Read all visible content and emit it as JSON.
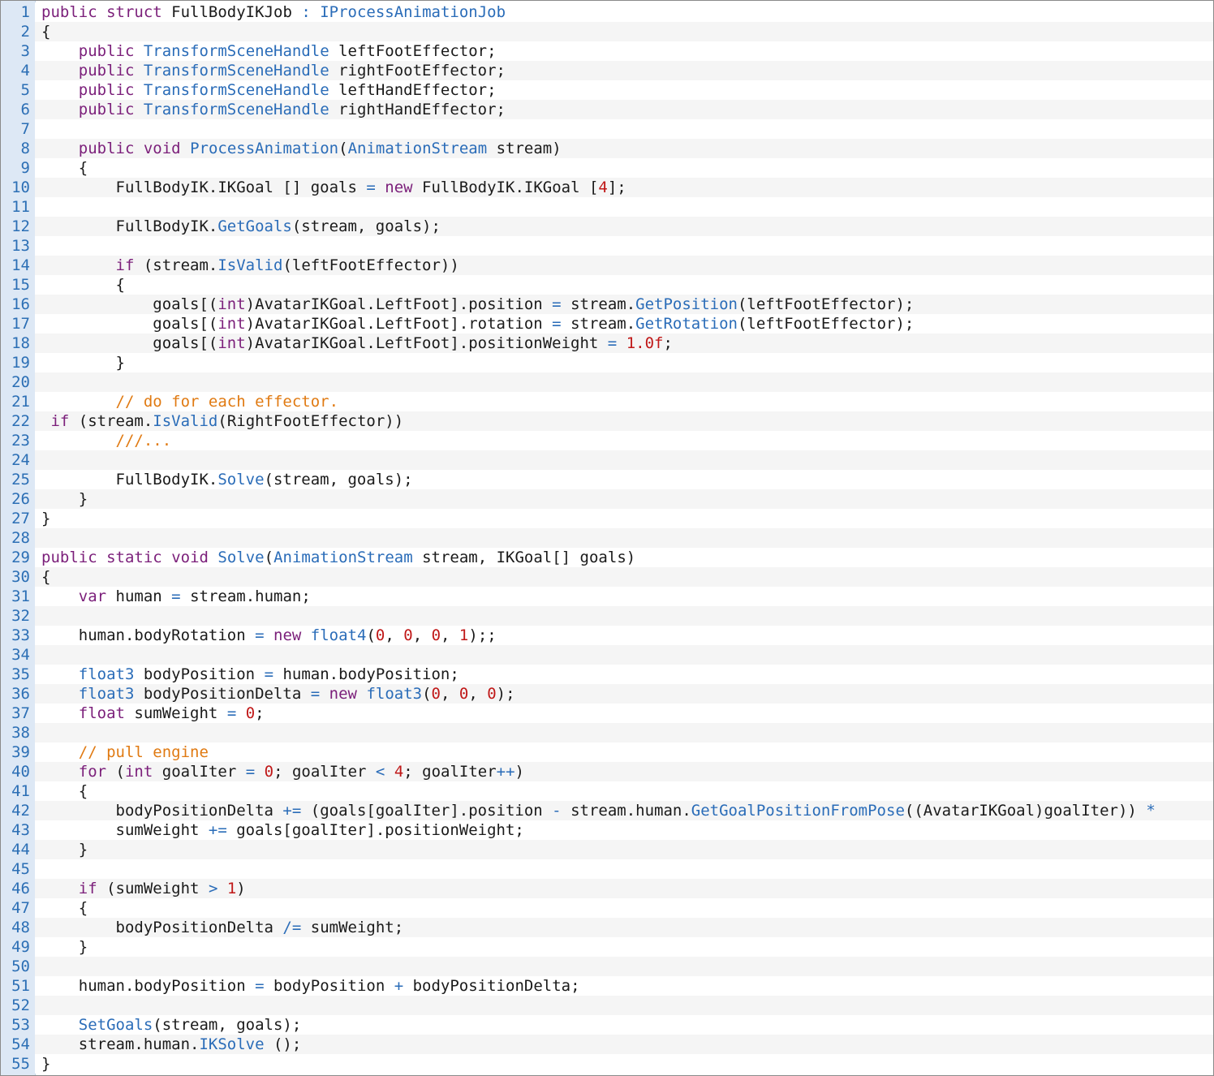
{
  "colors": {
    "keyword": "#7b1f7a",
    "type": "#2a6cb8",
    "number": "#c01818",
    "comment": "#e07a12",
    "text": "#1a1a1a",
    "line_number": "#2c6fb5",
    "gutter_bg": "#dde8f5",
    "alt_row_bg": "#f5f5f5"
  },
  "lines": [
    {
      "n": "1",
      "tokens": [
        [
          "kw",
          "public"
        ],
        [
          "p",
          " "
        ],
        [
          "kw",
          "struct"
        ],
        [
          "p",
          " FullBodyIKJob "
        ],
        [
          "op",
          ":"
        ],
        [
          "p",
          " "
        ],
        [
          "ty",
          "IProcessAnimationJob"
        ]
      ]
    },
    {
      "n": "2",
      "tokens": [
        [
          "p",
          "{"
        ]
      ]
    },
    {
      "n": "3",
      "tokens": [
        [
          "p",
          "    "
        ],
        [
          "kw",
          "public"
        ],
        [
          "p",
          " "
        ],
        [
          "ty",
          "TransformSceneHandle"
        ],
        [
          "p",
          " leftFootEffector;"
        ]
      ]
    },
    {
      "n": "4",
      "tokens": [
        [
          "p",
          "    "
        ],
        [
          "kw",
          "public"
        ],
        [
          "p",
          " "
        ],
        [
          "ty",
          "TransformSceneHandle"
        ],
        [
          "p",
          " rightFootEffector;"
        ]
      ]
    },
    {
      "n": "5",
      "tokens": [
        [
          "p",
          "    "
        ],
        [
          "kw",
          "public"
        ],
        [
          "p",
          " "
        ],
        [
          "ty",
          "TransformSceneHandle"
        ],
        [
          "p",
          " leftHandEffector;"
        ]
      ]
    },
    {
      "n": "6",
      "tokens": [
        [
          "p",
          "    "
        ],
        [
          "kw",
          "public"
        ],
        [
          "p",
          " "
        ],
        [
          "ty",
          "TransformSceneHandle"
        ],
        [
          "p",
          " rightHandEffector;"
        ]
      ]
    },
    {
      "n": "7",
      "tokens": []
    },
    {
      "n": "8",
      "tokens": [
        [
          "p",
          "    "
        ],
        [
          "kw",
          "public"
        ],
        [
          "p",
          " "
        ],
        [
          "kw",
          "void"
        ],
        [
          "p",
          " "
        ],
        [
          "fn",
          "ProcessAnimation"
        ],
        [
          "p",
          "("
        ],
        [
          "ty",
          "AnimationStream"
        ],
        [
          "p",
          " stream)"
        ]
      ]
    },
    {
      "n": "9",
      "tokens": [
        [
          "p",
          "    {"
        ]
      ]
    },
    {
      "n": "10",
      "tokens": [
        [
          "p",
          "        FullBodyIK.IKGoal [] goals "
        ],
        [
          "op",
          "="
        ],
        [
          "p",
          " "
        ],
        [
          "kw",
          "new"
        ],
        [
          "p",
          " FullBodyIK.IKGoal ["
        ],
        [
          "num",
          "4"
        ],
        [
          "p",
          "];"
        ]
      ]
    },
    {
      "n": "11",
      "tokens": []
    },
    {
      "n": "12",
      "tokens": [
        [
          "p",
          "        FullBodyIK."
        ],
        [
          "fn",
          "GetGoals"
        ],
        [
          "p",
          "(stream, goals);"
        ]
      ]
    },
    {
      "n": "13",
      "tokens": []
    },
    {
      "n": "14",
      "tokens": [
        [
          "p",
          "        "
        ],
        [
          "kw",
          "if"
        ],
        [
          "p",
          " (stream."
        ],
        [
          "fn",
          "IsValid"
        ],
        [
          "p",
          "(leftFootEffector))"
        ]
      ]
    },
    {
      "n": "15",
      "tokens": [
        [
          "p",
          "        {"
        ]
      ]
    },
    {
      "n": "16",
      "tokens": [
        [
          "p",
          "            goals[("
        ],
        [
          "kw",
          "int"
        ],
        [
          "p",
          ")AvatarIKGoal.LeftFoot].position "
        ],
        [
          "op",
          "="
        ],
        [
          "p",
          " stream."
        ],
        [
          "fn",
          "GetPosition"
        ],
        [
          "p",
          "(leftFootEffector);"
        ]
      ]
    },
    {
      "n": "17",
      "tokens": [
        [
          "p",
          "            goals[("
        ],
        [
          "kw",
          "int"
        ],
        [
          "p",
          ")AvatarIKGoal.LeftFoot].rotation "
        ],
        [
          "op",
          "="
        ],
        [
          "p",
          " stream."
        ],
        [
          "fn",
          "GetRotation"
        ],
        [
          "p",
          "(leftFootEffector);"
        ]
      ]
    },
    {
      "n": "18",
      "tokens": [
        [
          "p",
          "            goals[("
        ],
        [
          "kw",
          "int"
        ],
        [
          "p",
          ")AvatarIKGoal.LeftFoot].positionWeight "
        ],
        [
          "op",
          "="
        ],
        [
          "p",
          " "
        ],
        [
          "num",
          "1.0f"
        ],
        [
          "p",
          ";"
        ]
      ]
    },
    {
      "n": "19",
      "tokens": [
        [
          "p",
          "        }"
        ]
      ]
    },
    {
      "n": "20",
      "tokens": []
    },
    {
      "n": "21",
      "tokens": [
        [
          "p",
          "        "
        ],
        [
          "cm",
          "// do for each effector."
        ]
      ]
    },
    {
      "n": "22",
      "tokens": [
        [
          "p",
          " "
        ],
        [
          "kw",
          "if"
        ],
        [
          "p",
          " (stream."
        ],
        [
          "fn",
          "IsValid"
        ],
        [
          "p",
          "(RightFootEffector))"
        ]
      ]
    },
    {
      "n": "23",
      "tokens": [
        [
          "p",
          "        "
        ],
        [
          "cm",
          "///..."
        ]
      ]
    },
    {
      "n": "24",
      "tokens": []
    },
    {
      "n": "25",
      "tokens": [
        [
          "p",
          "        FullBodyIK."
        ],
        [
          "fn",
          "Solve"
        ],
        [
          "p",
          "(stream, goals);"
        ]
      ]
    },
    {
      "n": "26",
      "tokens": [
        [
          "p",
          "    }"
        ]
      ]
    },
    {
      "n": "27",
      "tokens": [
        [
          "p",
          "}"
        ]
      ]
    },
    {
      "n": "28",
      "tokens": []
    },
    {
      "n": "29",
      "tokens": [
        [
          "kw",
          "public"
        ],
        [
          "p",
          " "
        ],
        [
          "kw",
          "static"
        ],
        [
          "p",
          " "
        ],
        [
          "kw",
          "void"
        ],
        [
          "p",
          " "
        ],
        [
          "fn",
          "Solve"
        ],
        [
          "p",
          "("
        ],
        [
          "ty",
          "AnimationStream"
        ],
        [
          "p",
          " stream, IKGoal[] goals)"
        ]
      ]
    },
    {
      "n": "30",
      "tokens": [
        [
          "p",
          "{"
        ]
      ]
    },
    {
      "n": "31",
      "tokens": [
        [
          "p",
          "    "
        ],
        [
          "kw",
          "var"
        ],
        [
          "p",
          " human "
        ],
        [
          "op",
          "="
        ],
        [
          "p",
          " stream.human;"
        ]
      ]
    },
    {
      "n": "32",
      "tokens": []
    },
    {
      "n": "33",
      "tokens": [
        [
          "p",
          "    human.bodyRotation "
        ],
        [
          "op",
          "="
        ],
        [
          "p",
          " "
        ],
        [
          "kw",
          "new"
        ],
        [
          "p",
          " "
        ],
        [
          "ty",
          "float4"
        ],
        [
          "p",
          "("
        ],
        [
          "num",
          "0"
        ],
        [
          "p",
          ", "
        ],
        [
          "num",
          "0"
        ],
        [
          "p",
          ", "
        ],
        [
          "num",
          "0"
        ],
        [
          "p",
          ", "
        ],
        [
          "num",
          "1"
        ],
        [
          "p",
          ");;"
        ]
      ]
    },
    {
      "n": "34",
      "tokens": []
    },
    {
      "n": "35",
      "tokens": [
        [
          "p",
          "    "
        ],
        [
          "ty",
          "float3"
        ],
        [
          "p",
          " bodyPosition "
        ],
        [
          "op",
          "="
        ],
        [
          "p",
          " human.bodyPosition;"
        ]
      ]
    },
    {
      "n": "36",
      "tokens": [
        [
          "p",
          "    "
        ],
        [
          "ty",
          "float3"
        ],
        [
          "p",
          " bodyPositionDelta "
        ],
        [
          "op",
          "="
        ],
        [
          "p",
          " "
        ],
        [
          "kw",
          "new"
        ],
        [
          "p",
          " "
        ],
        [
          "ty",
          "float3"
        ],
        [
          "p",
          "("
        ],
        [
          "num",
          "0"
        ],
        [
          "p",
          ", "
        ],
        [
          "num",
          "0"
        ],
        [
          "p",
          ", "
        ],
        [
          "num",
          "0"
        ],
        [
          "p",
          ");"
        ]
      ]
    },
    {
      "n": "37",
      "tokens": [
        [
          "p",
          "    "
        ],
        [
          "kw",
          "float"
        ],
        [
          "p",
          " sumWeight "
        ],
        [
          "op",
          "="
        ],
        [
          "p",
          " "
        ],
        [
          "num",
          "0"
        ],
        [
          "p",
          ";"
        ]
      ]
    },
    {
      "n": "38",
      "tokens": []
    },
    {
      "n": "39",
      "tokens": [
        [
          "p",
          "    "
        ],
        [
          "cm",
          "// pull engine"
        ]
      ]
    },
    {
      "n": "40",
      "tokens": [
        [
          "p",
          "    "
        ],
        [
          "kw",
          "for"
        ],
        [
          "p",
          " ("
        ],
        [
          "kw",
          "int"
        ],
        [
          "p",
          " goalIter "
        ],
        [
          "op",
          "="
        ],
        [
          "p",
          " "
        ],
        [
          "num",
          "0"
        ],
        [
          "p",
          "; goalIter "
        ],
        [
          "op",
          "<"
        ],
        [
          "p",
          " "
        ],
        [
          "num",
          "4"
        ],
        [
          "p",
          "; goalIter"
        ],
        [
          "op",
          "++"
        ],
        [
          "p",
          ")"
        ]
      ]
    },
    {
      "n": "41",
      "tokens": [
        [
          "p",
          "    {"
        ]
      ]
    },
    {
      "n": "42",
      "tokens": [
        [
          "p",
          "        bodyPositionDelta "
        ],
        [
          "op",
          "+="
        ],
        [
          "p",
          " (goals[goalIter].position "
        ],
        [
          "op",
          "-"
        ],
        [
          "p",
          " stream.human."
        ],
        [
          "fn",
          "GetGoalPositionFromPose"
        ],
        [
          "p",
          "((AvatarIKGoal)goalIter)) "
        ],
        [
          "op",
          "*"
        ]
      ]
    },
    {
      "n": "43",
      "tokens": [
        [
          "p",
          "        sumWeight "
        ],
        [
          "op",
          "+="
        ],
        [
          "p",
          " goals[goalIter].positionWeight;"
        ]
      ]
    },
    {
      "n": "44",
      "tokens": [
        [
          "p",
          "    }"
        ]
      ]
    },
    {
      "n": "45",
      "tokens": []
    },
    {
      "n": "46",
      "tokens": [
        [
          "p",
          "    "
        ],
        [
          "kw",
          "if"
        ],
        [
          "p",
          " (sumWeight "
        ],
        [
          "op",
          ">"
        ],
        [
          "p",
          " "
        ],
        [
          "num",
          "1"
        ],
        [
          "p",
          ")"
        ]
      ]
    },
    {
      "n": "47",
      "tokens": [
        [
          "p",
          "    {"
        ]
      ]
    },
    {
      "n": "48",
      "tokens": [
        [
          "p",
          "        bodyPositionDelta "
        ],
        [
          "op",
          "/="
        ],
        [
          "p",
          " sumWeight;"
        ]
      ]
    },
    {
      "n": "49",
      "tokens": [
        [
          "p",
          "    }"
        ]
      ]
    },
    {
      "n": "50",
      "tokens": []
    },
    {
      "n": "51",
      "tokens": [
        [
          "p",
          "    human.bodyPosition "
        ],
        [
          "op",
          "="
        ],
        [
          "p",
          " bodyPosition "
        ],
        [
          "op",
          "+"
        ],
        [
          "p",
          " bodyPositionDelta;"
        ]
      ]
    },
    {
      "n": "52",
      "tokens": []
    },
    {
      "n": "53",
      "tokens": [
        [
          "p",
          "    "
        ],
        [
          "fn",
          "SetGoals"
        ],
        [
          "p",
          "(stream, goals);"
        ]
      ]
    },
    {
      "n": "54",
      "tokens": [
        [
          "p",
          "    stream.human."
        ],
        [
          "fn",
          "IKSolve"
        ],
        [
          "p",
          " ();"
        ]
      ]
    },
    {
      "n": "55",
      "tokens": [
        [
          "p",
          "}"
        ]
      ]
    }
  ]
}
